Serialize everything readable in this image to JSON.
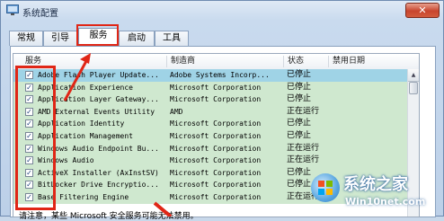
{
  "window": {
    "title": "系统配置",
    "close_label": "✕"
  },
  "tabs": [
    {
      "label": "常规",
      "active": false
    },
    {
      "label": "引导",
      "active": false
    },
    {
      "label": "服务",
      "active": true
    },
    {
      "label": "启动",
      "active": false
    },
    {
      "label": "工具",
      "active": false
    }
  ],
  "table": {
    "columns": [
      "服务",
      "制造商",
      "状态",
      "禁用日期"
    ],
    "rows": [
      {
        "name": "Adobe Flash Player Update...",
        "vendor": "Adobe Systems Incorp...",
        "status": "已停止",
        "checked": true
      },
      {
        "name": "Application Experience",
        "vendor": "Microsoft Corporation",
        "status": "已停止",
        "checked": true
      },
      {
        "name": "Application Layer Gateway...",
        "vendor": "Microsoft Corporation",
        "status": "已停止",
        "checked": true
      },
      {
        "name": "AMD External Events Utility",
        "vendor": "AMD",
        "status": "正在运行",
        "checked": true
      },
      {
        "name": "Application Identity",
        "vendor": "Microsoft Corporation",
        "status": "已停止",
        "checked": true
      },
      {
        "name": "Application Management",
        "vendor": "Microsoft Corporation",
        "status": "已停止",
        "checked": true
      },
      {
        "name": "Windows Audio Endpoint Bu...",
        "vendor": "Microsoft Corporation",
        "status": "正在运行",
        "checked": true
      },
      {
        "name": "Windows Audio",
        "vendor": "Microsoft Corporation",
        "status": "正在运行",
        "checked": true
      },
      {
        "name": "ActiveX Installer (AxInstSV)",
        "vendor": "Microsoft Corporation",
        "status": "已停止",
        "checked": true
      },
      {
        "name": "BitLocker Drive Encryptio...",
        "vendor": "Microsoft Corporation",
        "status": "已停止",
        "checked": true
      },
      {
        "name": "Base Filtering Engine",
        "vendor": "Microsoft Corporation",
        "status": "正在运行",
        "checked": true
      }
    ]
  },
  "note": "请注意，某些 Microsoft 安全服务可能无法禁用。",
  "watermark": {
    "title": "系统之家",
    "url": "Win10net.com"
  },
  "colors": {
    "highlight": "#e02616",
    "row_bg": "#cfe8cf",
    "selected_row_bg": "#9fd3e6"
  }
}
